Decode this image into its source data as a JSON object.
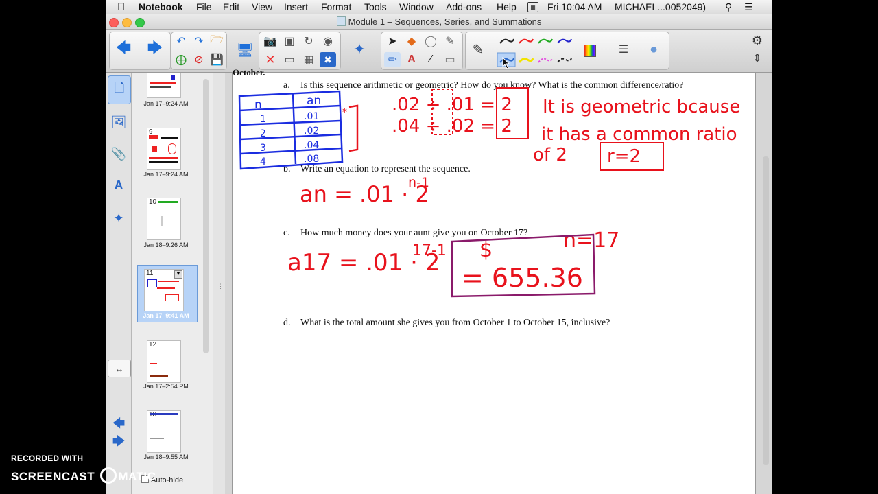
{
  "menubar": {
    "apple": "",
    "app_name": "Notebook",
    "items": [
      "File",
      "Edit",
      "View",
      "Insert",
      "Format",
      "Tools",
      "Window",
      "Add-ons",
      "Help"
    ],
    "clock": "Fri 10:04 AM",
    "user": "MICHAEL...0052049)"
  },
  "window": {
    "title": "Module 1 – Sequences, Series, and Summations"
  },
  "toolbar": {
    "icons": [
      "back-arrow",
      "forward-arrow",
      "undo",
      "redo",
      "open-folder",
      "add-page",
      "delete-page",
      "save",
      "screen-shade",
      "table",
      "delete",
      "cursor",
      "magic-pen",
      "pen",
      "text",
      "line",
      "eraser",
      "fill",
      "color-palette",
      "properties",
      "settings"
    ]
  },
  "sidebar": {
    "tabs": [
      "page-sorter",
      "gallery",
      "attachments",
      "properties",
      "add-ons"
    ],
    "thumbnails": [
      {
        "num": "",
        "date": "Jan 17–9:24 AM"
      },
      {
        "num": "9",
        "date": "Jan 17–9:24 AM"
      },
      {
        "num": "10",
        "date": "Jan 18–9:26 AM"
      },
      {
        "num": "11",
        "date": "Jan 17–9:41 AM"
      },
      {
        "num": "12",
        "date": "Jan 17–2:54 PM"
      },
      {
        "num": "13",
        "date": "Jan 18–9:55 AM"
      }
    ],
    "autohide_label": "Auto-hide"
  },
  "page": {
    "cutoff_text": "October.",
    "questions": [
      {
        "letter": "a.",
        "text": "Is this sequence arithmetic or geometric? How do you know? What is the common difference/ratio?"
      },
      {
        "letter": "b.",
        "text": "Write an equation to represent the sequence."
      },
      {
        "letter": "c.",
        "text": "How much money does your aunt give you on October 17?"
      },
      {
        "letter": "d.",
        "text": "What is the total amount she gives you from October 1 to October 15, inclusive?"
      }
    ],
    "handwriting": {
      "table_headers": [
        "n",
        "an"
      ],
      "table_rows": [
        [
          "1",
          ".01"
        ],
        [
          "2",
          ".02"
        ],
        [
          "3",
          ".04"
        ],
        [
          "4",
          ".08"
        ]
      ],
      "ratio_line1": ".02 ÷ .01 = 2",
      "ratio_line2": ".04 ÷ .02 = 2",
      "explanation1": "It is geometric bcause",
      "explanation2": "it has a common ratio",
      "explanation3": "of 2",
      "ratio_box": "r=2",
      "equation_b": "an = .01 · 2",
      "equation_b_exp": "n-1",
      "n_value": "n=17",
      "equation_c": "a17 = .01 · 2",
      "equation_c_exp": "17-1",
      "answer_c": "= 655.36",
      "dollar": "$"
    }
  },
  "watermark": {
    "line1": "RECORDED WITH",
    "line2": "SCREENCAST",
    "line3": "MATIC"
  },
  "colors": {
    "ink_red": "#e8121c",
    "ink_blue": "#1b2de0",
    "selection": "#b7d3f7"
  }
}
